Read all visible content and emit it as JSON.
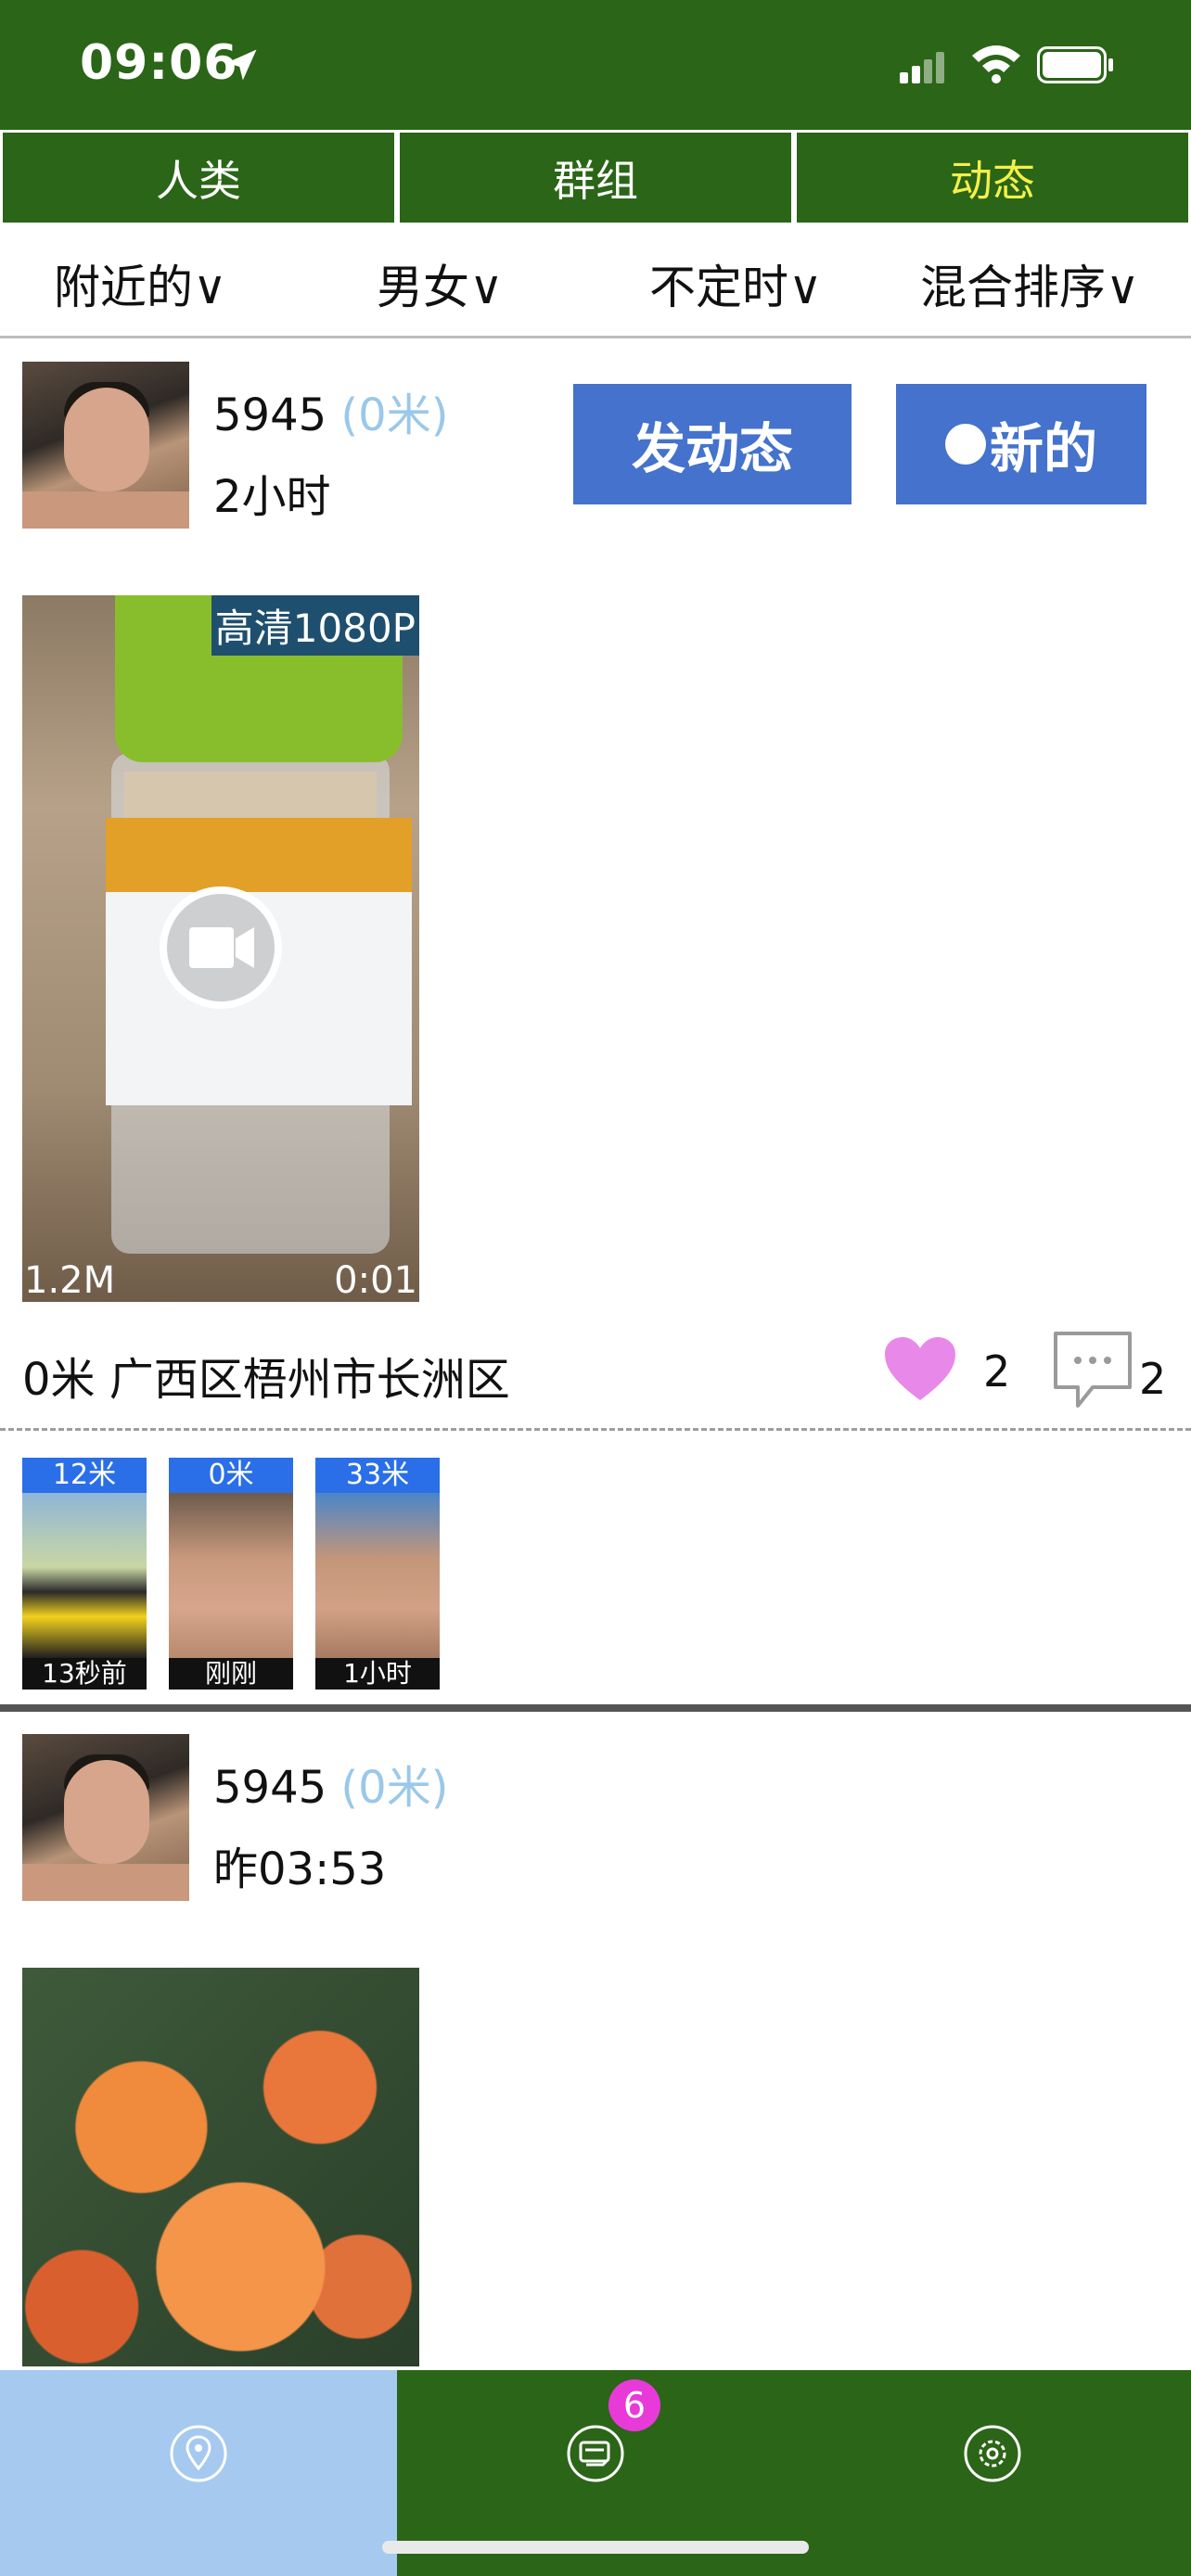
{
  "status_bar": {
    "time": "09:06"
  },
  "main_tabs": [
    {
      "label": "人类"
    },
    {
      "label": "群组"
    },
    {
      "label": "动态",
      "active": true
    }
  ],
  "filters": [
    {
      "label": "附近的∨"
    },
    {
      "label": "男女∨"
    },
    {
      "label": "不定时∨"
    },
    {
      "label": "混合排序∨"
    }
  ],
  "actions": {
    "post_label": "发动态",
    "new_label": "新的"
  },
  "posts": [
    {
      "username": "5945",
      "distance": "(0米)",
      "time": "2小时",
      "video": {
        "quality": "高清1080P",
        "size": "1.2M",
        "duration": "0:01"
      },
      "location": "0米 广西区梧州市长洲区",
      "likes": "2",
      "comments": "2",
      "viewers": [
        {
          "distance": "12米",
          "time": "13秒前"
        },
        {
          "distance": "0米",
          "time": "刚刚"
        },
        {
          "distance": "33米",
          "time": "1小时"
        }
      ]
    },
    {
      "username": "5945",
      "distance": "(0米)",
      "time": "昨03:53"
    }
  ],
  "bottom_nav": {
    "message_badge": "6"
  },
  "colors": {
    "header_green": "#2b6517",
    "active_tab_text": "#f4f04a",
    "button_blue": "#4472cc",
    "nav_active": "#a6c9f0",
    "badge_magenta": "#e83ad8"
  }
}
